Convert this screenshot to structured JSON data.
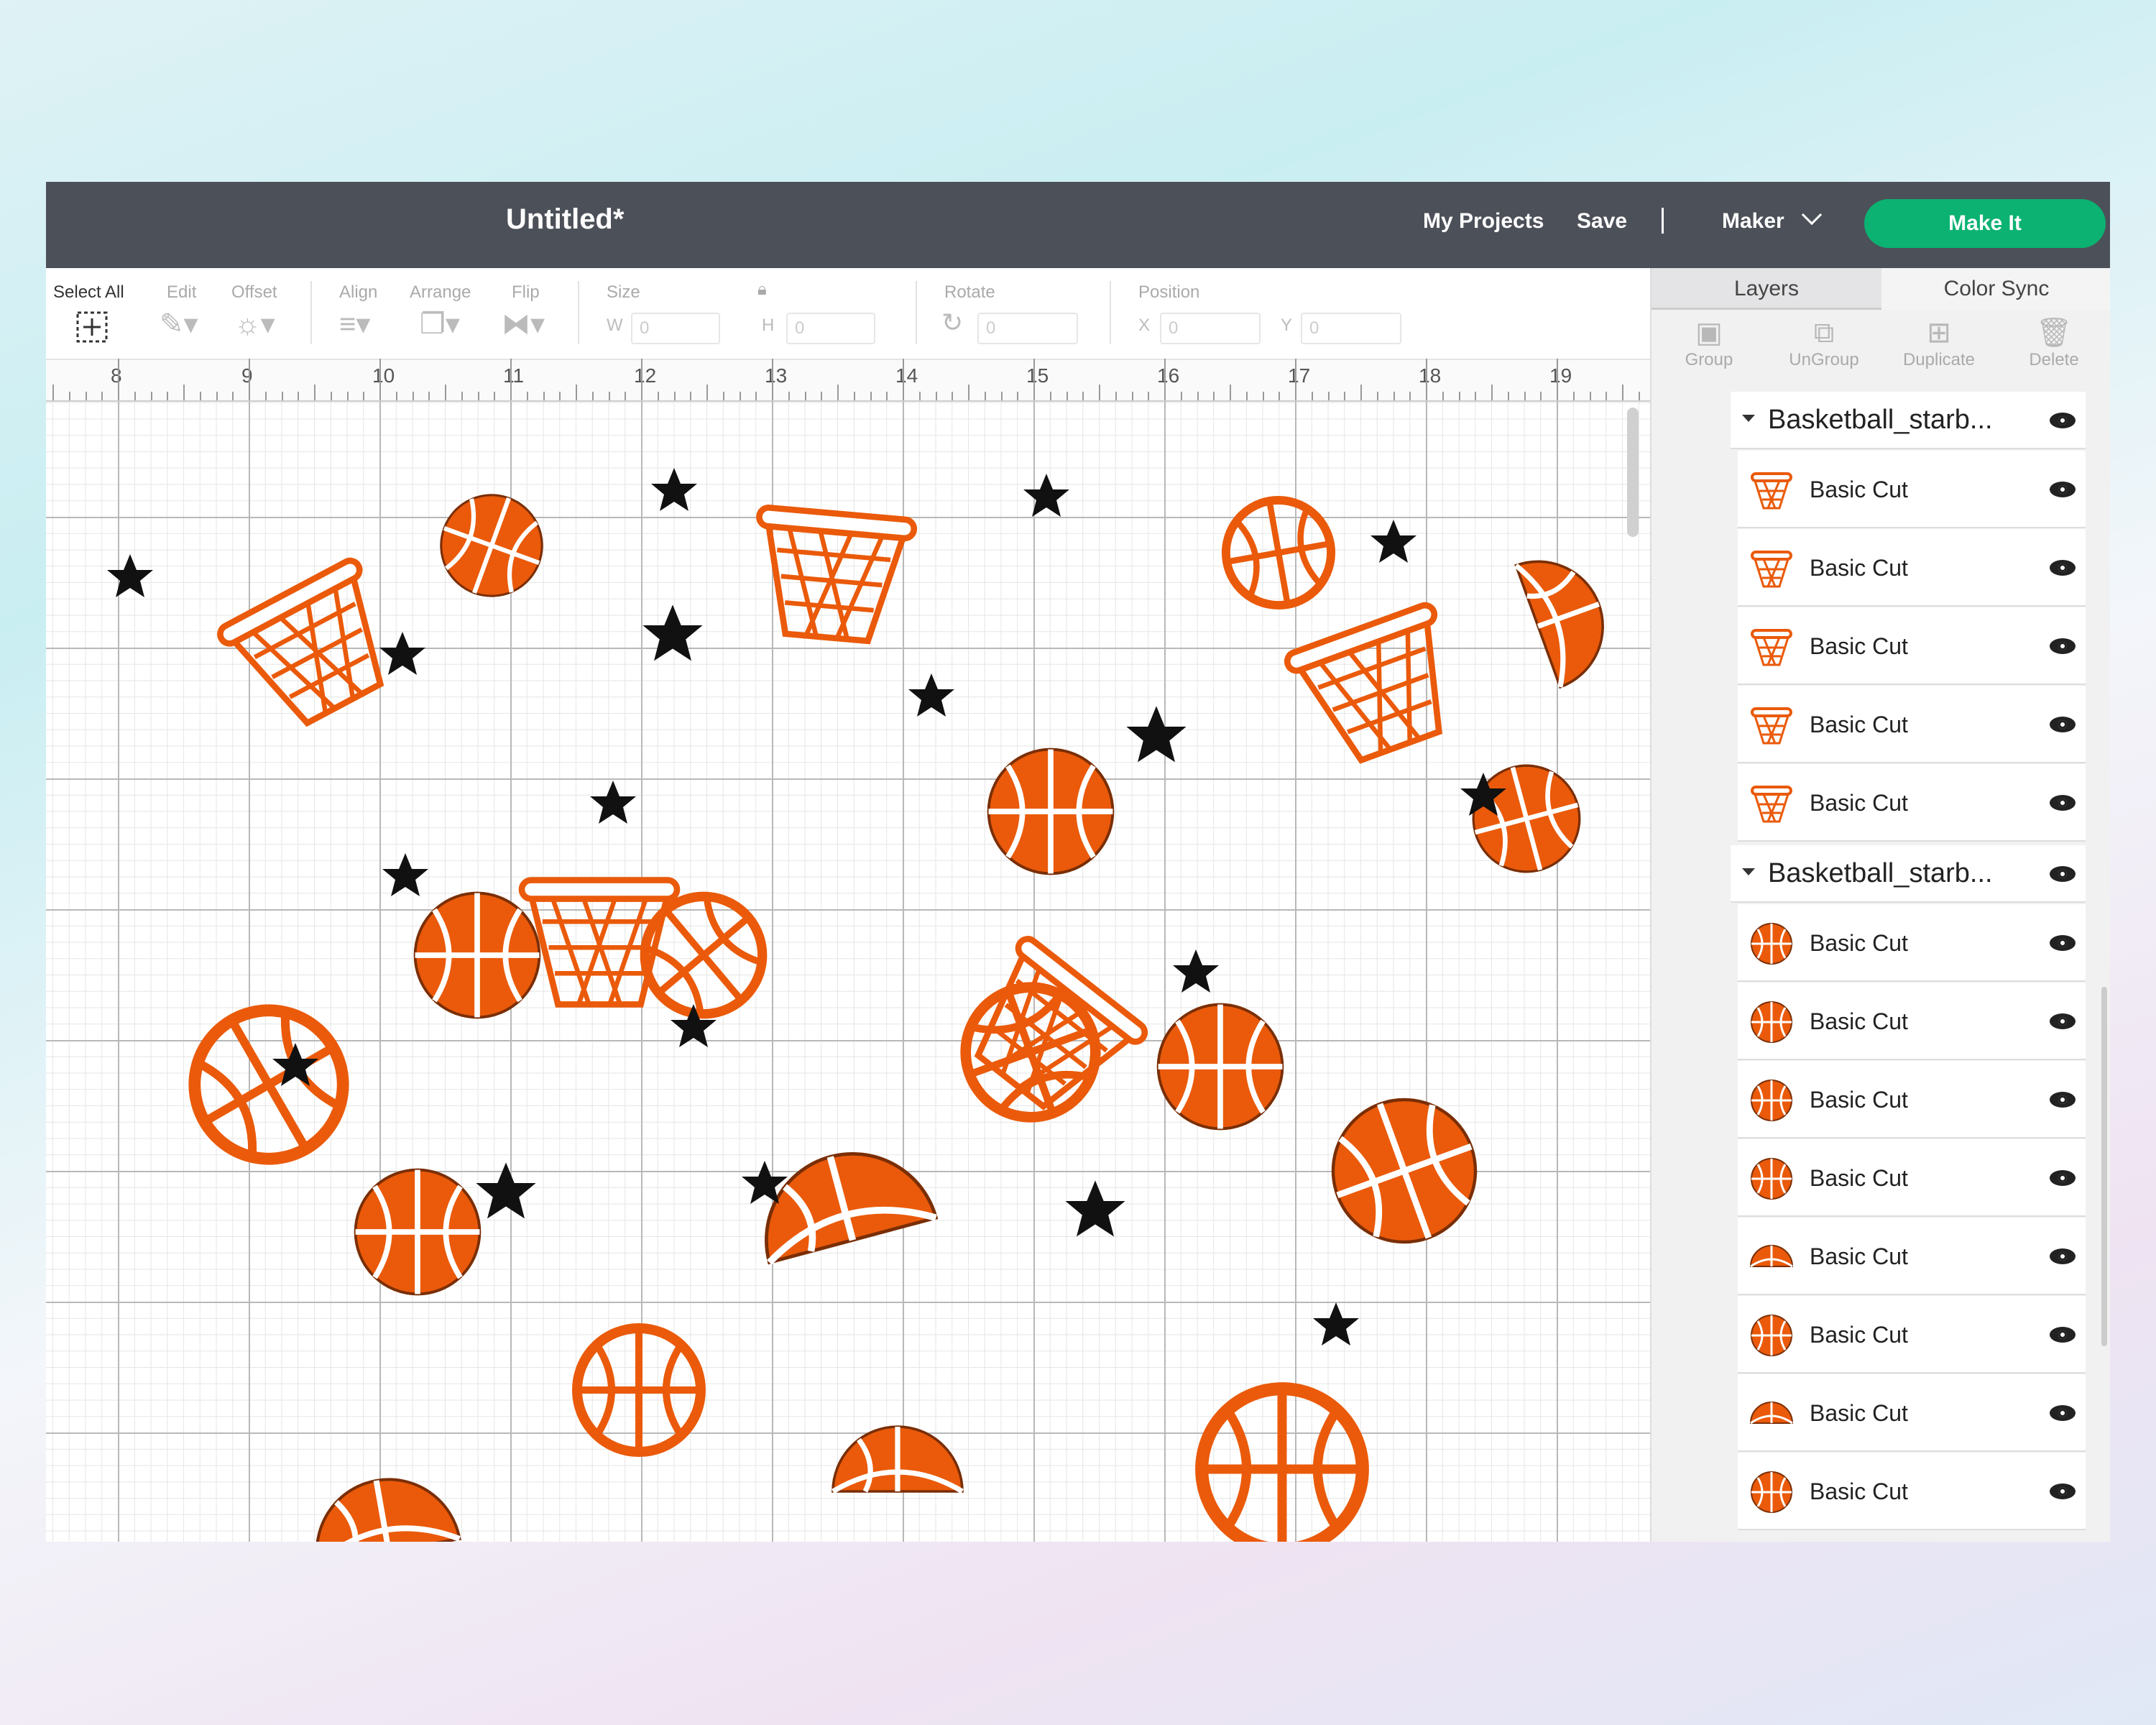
{
  "header": {
    "title": "Untitled*",
    "my_projects": "My Projects",
    "save": "Save",
    "separator": "|",
    "machine": "Maker",
    "make_it": "Make It"
  },
  "toolbar": {
    "select_all": "Select All",
    "edit": "Edit",
    "offset": "Offset",
    "align": "Align",
    "arrange": "Arrange",
    "flip": "Flip",
    "size": "Size",
    "size_w_label": "W",
    "size_w_value": "0",
    "size_h_label": "H",
    "size_h_value": "0",
    "rotate": "Rotate",
    "rotate_value": "0",
    "position": "Position",
    "pos_x_label": "X",
    "pos_x_value": "0",
    "pos_y_label": "Y",
    "pos_y_value": "0"
  },
  "ruler": {
    "numbers": [
      "8",
      "9",
      "10",
      "11",
      "12",
      "13",
      "14",
      "15",
      "16",
      "17",
      "18",
      "19"
    ]
  },
  "panel": {
    "tabs": [
      "Layers",
      "Color Sync"
    ],
    "actions": [
      "Group",
      "UnGroup",
      "Duplicate",
      "Delete"
    ],
    "groups": [
      {
        "name": "Basketball_starb...",
        "layers": [
          {
            "name": "Basic Cut",
            "icon": "hoop"
          },
          {
            "name": "Basic Cut",
            "icon": "hoop"
          },
          {
            "name": "Basic Cut",
            "icon": "hoop"
          },
          {
            "name": "Basic Cut",
            "icon": "hoop"
          },
          {
            "name": "Basic Cut",
            "icon": "hoop"
          }
        ]
      },
      {
        "name": "Basketball_starb...",
        "layers": [
          {
            "name": "Basic Cut",
            "icon": "ball"
          },
          {
            "name": "Basic Cut",
            "icon": "ball"
          },
          {
            "name": "Basic Cut",
            "icon": "ball"
          },
          {
            "name": "Basic Cut",
            "icon": "ball"
          },
          {
            "name": "Basic Cut",
            "icon": "ball-half"
          },
          {
            "name": "Basic Cut",
            "icon": "ball"
          },
          {
            "name": "Basic Cut",
            "icon": "ball-half"
          },
          {
            "name": "Basic Cut",
            "icon": "ball"
          }
        ]
      }
    ]
  },
  "colors": {
    "header_bg": "#4c5058",
    "accent_green": "#0bb272",
    "ball_orange": "#ea5a0a",
    "star_black": "#111111"
  }
}
